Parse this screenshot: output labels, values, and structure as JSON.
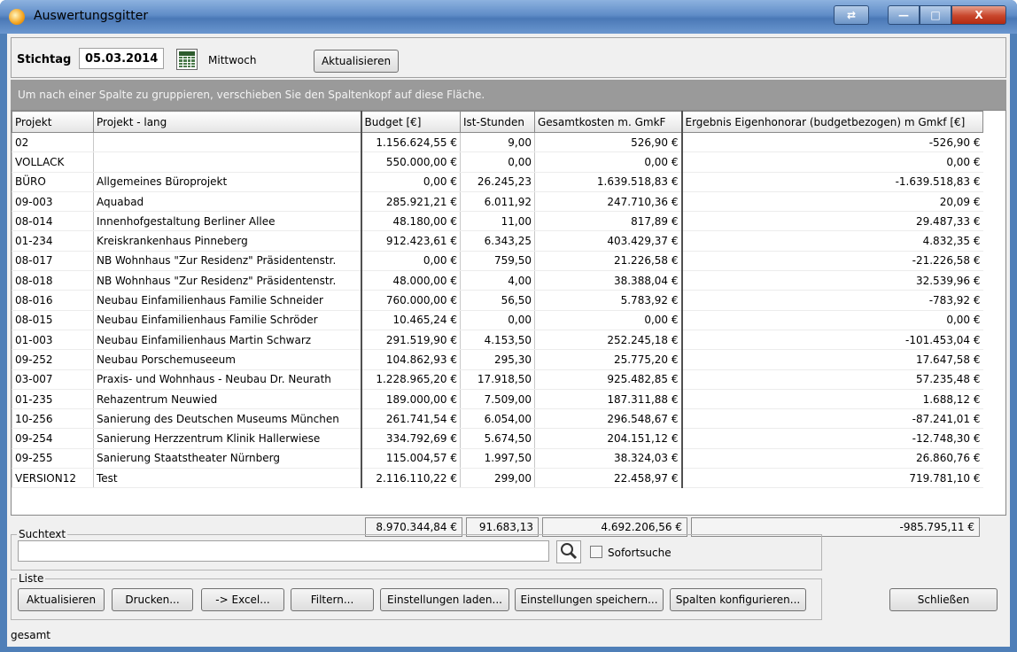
{
  "window": {
    "title": "Auswertungsgitter",
    "min_glyph": "—",
    "max_glyph": "□",
    "close_glyph": "X",
    "aux_glyph": "⇄"
  },
  "toolbar": {
    "stichtag_label": "Stichtag",
    "date_value": "05.03.2014",
    "weekday": "Mittwoch",
    "refresh_label": "Aktualisieren"
  },
  "group_hint": "Um nach einer Spalte zu gruppieren, verschieben Sie den Spaltenkopf auf diese Fläche.",
  "table": {
    "columns": [
      "Projekt",
      "Projekt - lang",
      "Budget [€]",
      "Ist-Stunden",
      "Gesamtkosten m. GmkF",
      "Ergebnis Eigenhonorar (budgetbezogen) m Gmkf [€]"
    ],
    "rows": [
      [
        "02",
        "",
        "1.156.624,55 €",
        "9,00",
        "526,90 €",
        "-526,90 €"
      ],
      [
        "VOLLACK",
        "",
        "550.000,00 €",
        "0,00",
        "0,00 €",
        "0,00 €"
      ],
      [
        "BÜRO",
        "Allgemeines Büroprojekt",
        "0,00 €",
        "26.245,23",
        "1.639.518,83 €",
        "-1.639.518,83 €"
      ],
      [
        "09-003",
        "Aquabad",
        "285.921,21 €",
        "6.011,92",
        "247.710,36 €",
        "20,09 €"
      ],
      [
        "08-014",
        "Innenhofgestaltung Berliner Allee",
        "48.180,00 €",
        "11,00",
        "817,89 €",
        "29.487,33 €"
      ],
      [
        "01-234",
        "Kreiskrankenhaus Pinneberg",
        "912.423,61 €",
        "6.343,25",
        "403.429,37 €",
        "4.832,35 €"
      ],
      [
        "08-017",
        "NB Wohnhaus \"Zur Residenz\" Präsidentenstr.",
        "0,00 €",
        "759,50",
        "21.226,58 €",
        "-21.226,58 €"
      ],
      [
        "08-018",
        "NB Wohnhaus \"Zur Residenz\" Präsidentenstr.",
        "48.000,00 €",
        "4,00",
        "38.388,04 €",
        "32.539,96 €"
      ],
      [
        "08-016",
        "Neubau Einfamilienhaus Familie Schneider",
        "760.000,00 €",
        "56,50",
        "5.783,92 €",
        "-783,92 €"
      ],
      [
        "08-015",
        "Neubau Einfamilienhaus Familie Schröder",
        "10.465,24 €",
        "0,00",
        "0,00 €",
        "0,00 €"
      ],
      [
        "01-003",
        "Neubau Einfamilienhaus Martin Schwarz",
        "291.519,90 €",
        "4.153,50",
        "252.245,18 €",
        "-101.453,04 €"
      ],
      [
        "09-252",
        "Neubau Porschemuseeum",
        "104.862,93 €",
        "295,30",
        "25.775,20 €",
        "17.647,58 €"
      ],
      [
        "03-007",
        "Praxis- und Wohnhaus - Neubau Dr. Neurath",
        "1.228.965,20 €",
        "17.918,50",
        "925.482,85 €",
        "57.235,48 €"
      ],
      [
        "01-235",
        "Rehazentrum Neuwied",
        "189.000,00 €",
        "7.509,00",
        "187.311,88 €",
        "1.688,12 €"
      ],
      [
        "10-256",
        "Sanierung des Deutschen Museums München",
        "261.741,54 €",
        "6.054,00",
        "296.548,67 €",
        "-87.241,01 €"
      ],
      [
        "09-254",
        "Sanierung Herzzentrum Klinik Hallerwiese",
        "334.792,69 €",
        "5.674,50",
        "204.151,12 €",
        "-12.748,30 €"
      ],
      [
        "09-255",
        "Sanierung Staatstheater Nürnberg",
        "115.004,57 €",
        "1.997,50",
        "38.324,03 €",
        "26.860,76 €"
      ],
      [
        "VERSION12",
        "Test",
        "2.116.110,22 €",
        "299,00",
        "22.458,97 €",
        "719.781,10 €"
      ]
    ],
    "totals": {
      "budget": "8.970.344,84 €",
      "hours": "91.683,13",
      "costs": "4.692.206,56 €",
      "result": "-985.795,11 €"
    }
  },
  "search": {
    "legend": "Suchtext",
    "value": "",
    "sofort_label": "Sofortsuche"
  },
  "list": {
    "legend": "Liste",
    "buttons": [
      "Aktualisieren",
      "Drucken...",
      "-> Excel...",
      "Filtern...",
      "Einstellungen laden...",
      "Einstellungen speichern...",
      "Spalten konfigurieren..."
    ]
  },
  "close_label": "Schließen",
  "status_text": "gesamt"
}
